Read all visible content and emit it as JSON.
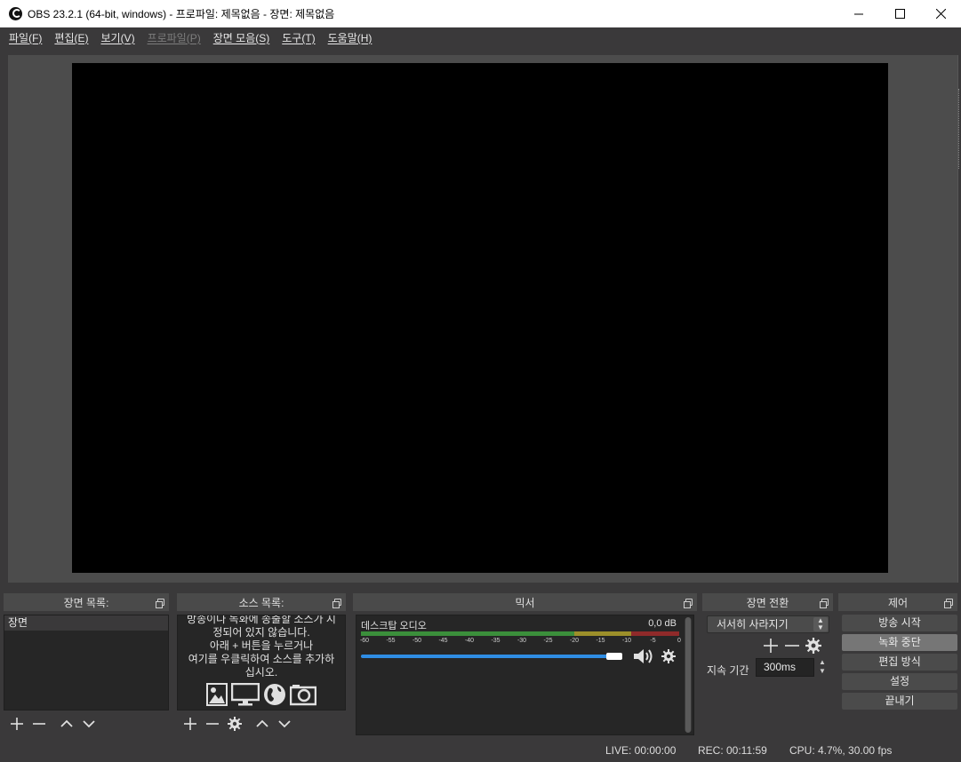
{
  "window": {
    "title": "OBS 23.2.1 (64-bit, windows) - 프로파일: 제목없음 - 장면: 제목없음",
    "app_icon": "obs-logo-icon",
    "controls": [
      "minimize-icon",
      "maximize-icon",
      "close-icon"
    ]
  },
  "menu": [
    {
      "label": "파일(F)",
      "enabled": true
    },
    {
      "label": "편집(E)",
      "enabled": true
    },
    {
      "label": "보기(V)",
      "enabled": true
    },
    {
      "label": "프로파일(P)",
      "enabled": false
    },
    {
      "label": "장면 모음(S)",
      "enabled": true
    },
    {
      "label": "도구(T)",
      "enabled": true
    },
    {
      "label": "도움말(H)",
      "enabled": true
    }
  ],
  "scenes": {
    "title": "장면 목록:",
    "items": [
      "장면"
    ],
    "toolbar_icons": [
      "add-icon",
      "remove-icon",
      "move-up-icon",
      "move-down-icon"
    ]
  },
  "sources": {
    "title": "소스 목록:",
    "hint_lines": [
      "방송이나 녹화에 송출할 소스가 지",
      "정되어 있지 않습니다.",
      "아래 + 버튼을 누르거나",
      "여기를 우클릭하여 소스를 추가하",
      "십시오."
    ],
    "hint_icons": [
      "image-icon",
      "display-icon",
      "browser-globe-icon",
      "camera-icon"
    ],
    "toolbar_icons": [
      "add-icon",
      "remove-icon",
      "gear-icon",
      "move-up-icon",
      "move-down-icon"
    ]
  },
  "mixer": {
    "title": "믹서",
    "channel": {
      "name": "데스크탑 오디오",
      "level": "0,0 dB",
      "volume": 0.94,
      "scale": [
        "-60",
        "-55",
        "-50",
        "-45",
        "-40",
        "-35",
        "-30",
        "-25",
        "-20",
        "-15",
        "-10",
        "-5",
        "0"
      ],
      "meter_colors": {
        "green": "#3b8f3b",
        "yellow": "#9c8f2a",
        "red": "#8f2a2a"
      },
      "icons": [
        "speaker-icon",
        "gear-icon"
      ]
    }
  },
  "transitions": {
    "title": "장면 전환",
    "selected": "서서히 사라지기",
    "duration_label": "지속 기간",
    "duration_value": "300ms",
    "icons": [
      "add-icon",
      "remove-icon",
      "gear-icon"
    ]
  },
  "controls": {
    "title": "제어",
    "buttons": [
      {
        "label": "방송 시작",
        "active": false
      },
      {
        "label": "녹화 중단",
        "active": true
      },
      {
        "label": "편집 방식",
        "active": false
      },
      {
        "label": "설정",
        "active": false
      },
      {
        "label": "끝내기",
        "active": false
      }
    ]
  },
  "status": {
    "live": "LIVE: 00:00:00",
    "rec": "REC: 00:11:59",
    "cpu": "CPU: 4.7%, 30.00 fps"
  },
  "colors": {
    "background": "#3a393a",
    "panel": "#272727",
    "accent_blue": "#2f8de4"
  }
}
